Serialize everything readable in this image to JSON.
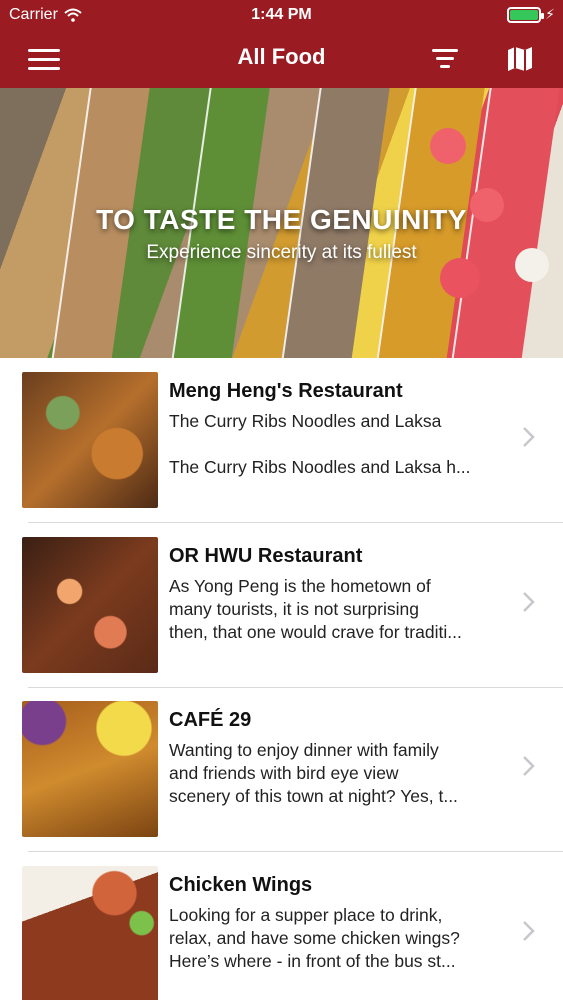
{
  "status_bar": {
    "carrier": "Carrier",
    "time": "1:44 PM",
    "battery_level": 1.0,
    "charging": true
  },
  "nav": {
    "title": "All Food",
    "icons": {
      "left": "hamburger-menu-icon",
      "filter": "filter-icon",
      "map": "map-icon"
    }
  },
  "banner": {
    "title": "TO TASTE THE GENUINITY",
    "subtitle": "Experience sincerity at its fullest"
  },
  "restaurants": [
    {
      "name": "Meng Heng's Restaurant",
      "lines": [
        "The Curry Ribs Noodles and Laksa",
        "",
        "The Curry Ribs Noodles and Laksa h..."
      ]
    },
    {
      "name": "OR HWU Restaurant",
      "lines": [
        "As Yong Peng is the hometown of",
        "many tourists, it is not surprising",
        "then, that one would crave for traditi..."
      ]
    },
    {
      "name": "CAFÉ 29",
      "lines": [
        "Wanting to enjoy dinner with family",
        "and friends with bird eye view",
        "scenery of this town at night? Yes, t..."
      ]
    },
    {
      "name": "Chicken Wings",
      "lines": [
        "Looking for a supper place to drink,",
        "relax, and have some chicken wings?",
        "Here’s where - in front of the bus st..."
      ]
    }
  ],
  "colors": {
    "brand": "#9b1b22",
    "battery": "#35c759"
  }
}
